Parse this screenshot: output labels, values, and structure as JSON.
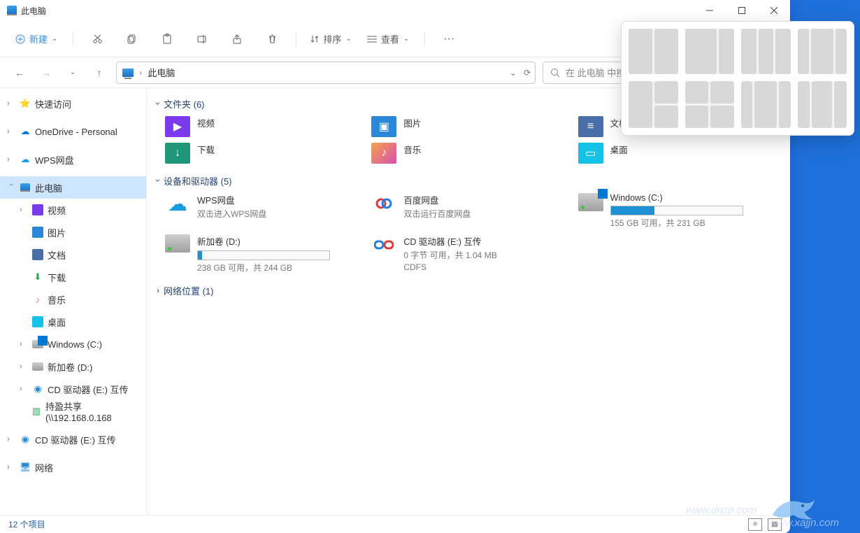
{
  "title": "此电脑",
  "toolbar": {
    "new": "新建",
    "sort": "排序",
    "view": "查看"
  },
  "nav": {
    "breadcrumb_sep": "›",
    "breadcrumb": "此电脑",
    "search_placeholder": "在 此电脑 中搜"
  },
  "sidebar": {
    "quick": "快速访问",
    "onedrive": "OneDrive - Personal",
    "wps": "WPS网盘",
    "thispc": "此电脑",
    "items": [
      "视频",
      "图片",
      "文档",
      "下载",
      "音乐",
      "桌面",
      "Windows (C:)",
      "新加卷 (D:)",
      "CD 驱动器 (E:) 互传",
      "持盈共享 (\\\\192.168.0.168"
    ],
    "cd2": "CD 驱动器 (E:) 互传",
    "network": "网络"
  },
  "groups": {
    "folders_h": "文件夹 (6)",
    "folders": [
      "视频",
      "图片",
      "文档",
      "下载",
      "音乐",
      "桌面"
    ],
    "devices_h": "设备和驱动器 (5)",
    "wps_item": "WPS网盘",
    "wps_sub": "双击进入WPS网盘",
    "baidu_item": "百度网盘",
    "baidu_sub": "双击运行百度网盘",
    "c_item": "Windows (C:)",
    "c_sub": "155 GB 可用，共 231 GB",
    "c_fill_pct": 33,
    "d_item": "新加卷 (D:)",
    "d_sub": "238 GB 可用，共 244 GB",
    "d_fill_pct": 3,
    "e_item": "CD 驱动器 (E:) 互传",
    "e_sub1": "0 字节 可用，共 1.04 MB",
    "e_sub2": "CDFS",
    "netloc_h": "网络位置 (1)"
  },
  "status": {
    "count": "12 个项目"
  },
  "watermarks": {
    "w1": "www.xajjn.com",
    "w2": "www.dnzp.com"
  }
}
